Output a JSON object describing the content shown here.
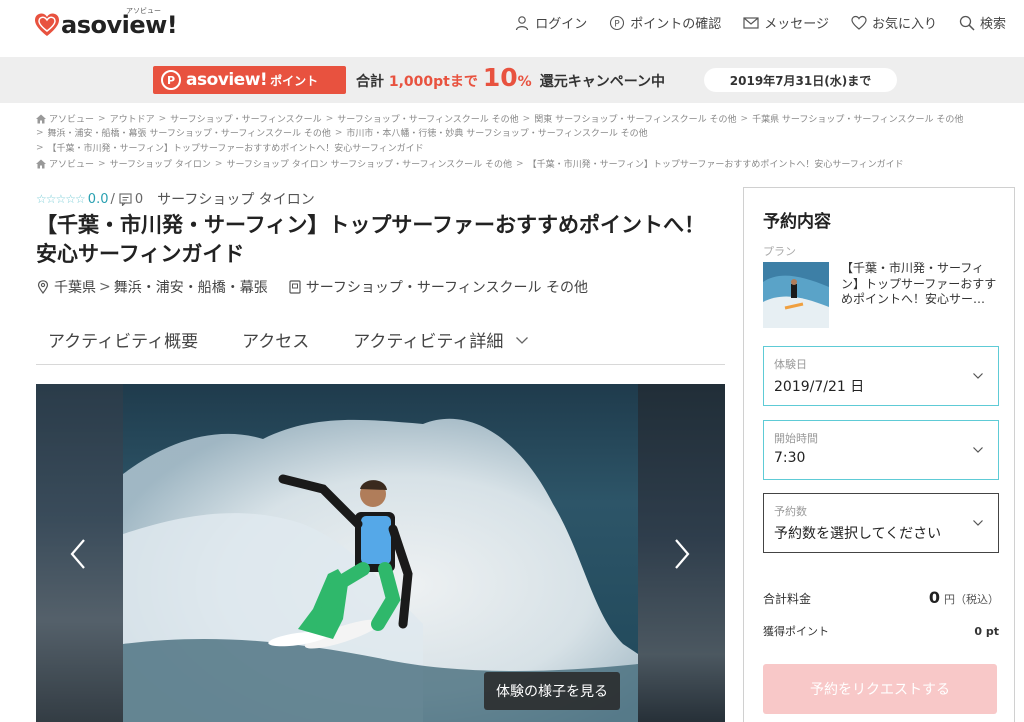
{
  "header": {
    "logo_text": "asoview!",
    "logo_sub": "アソビュー",
    "nav": {
      "login": "ログイン",
      "points": "ポイントの確認",
      "message": "メッセージ",
      "favorites": "お気に入り",
      "search": "検索"
    }
  },
  "campaign": {
    "badge_brand": "asoview!",
    "badge_label": "ポイント",
    "text_prefix": "合計",
    "text_points": "1,000ptまで",
    "percent_num": "10",
    "percent_sign": "%",
    "text_suffix": "還元キャンペーン中",
    "date": "2019年7月31日(水)まで"
  },
  "breadcrumbs": {
    "line1": [
      "アソビュー",
      "アウトドア",
      "サーフショップ・サーフィンスクール",
      "サーフショップ・サーフィンスクール その他",
      "関東 サーフショップ・サーフィンスクール その他",
      "千葉県 サーフショップ・サーフィンスクール その他"
    ],
    "line2": [
      "舞浜・浦安・船橋・幕張 サーフショップ・サーフィンスクール その他",
      "市川市・本八幡・行徳・妙典 サーフショップ・サーフィンスクール その他"
    ],
    "line3": [
      "【千葉・市川発・サーフィン】トップサーファーおすすめポイントへ！安心サーフィンガイド"
    ],
    "line4": [
      "アソビュー",
      "サーフショップ タイロン",
      "サーフショップ タイロン サーフショップ・サーフィンスクール その他",
      "【千葉・市川発・サーフィン】トップサーファーおすすめポイントへ！安心サーフィンガイド"
    ]
  },
  "activity": {
    "stars": "☆☆☆☆☆",
    "score": "0.0",
    "slash": "/",
    "review_count": "0",
    "shop_name": "サーフショップ タイロン",
    "title": "【千葉・市川発・サーフィン】トップサーファーおすすめポイントへ！安心サーフィンガイド",
    "prefecture": "千葉県",
    "area": "舞浜・浦安・船橋・幕張",
    "category": "サーフショップ・サーフィンスクール その他"
  },
  "tabs": [
    "アクティビティ概要",
    "アクセス",
    "アクティビティ詳細"
  ],
  "gallery": {
    "view_button": "体験の様子を見る"
  },
  "reservation": {
    "heading": "予約内容",
    "plan_label": "プラン",
    "plan_text": "【千葉・市川発・サーフィン】トップサーファーおすすめポイントへ！安心サー…",
    "date_label": "体験日",
    "date_value": "2019/7/21 日",
    "time_label": "開始時間",
    "time_value": "7:30",
    "count_label": "予約数",
    "count_value": "予約数を選択してください",
    "total_label": "合計料金",
    "total_amount": "0",
    "total_unit": "円（税込）",
    "points_label": "獲得ポイント",
    "points_value": "0 pt",
    "submit": "予約をリクエストする"
  },
  "colors": {
    "brand_red": "#e8523f",
    "accent_teal": "#5ecbd6",
    "submit_disabled": "#f8c8c8"
  }
}
